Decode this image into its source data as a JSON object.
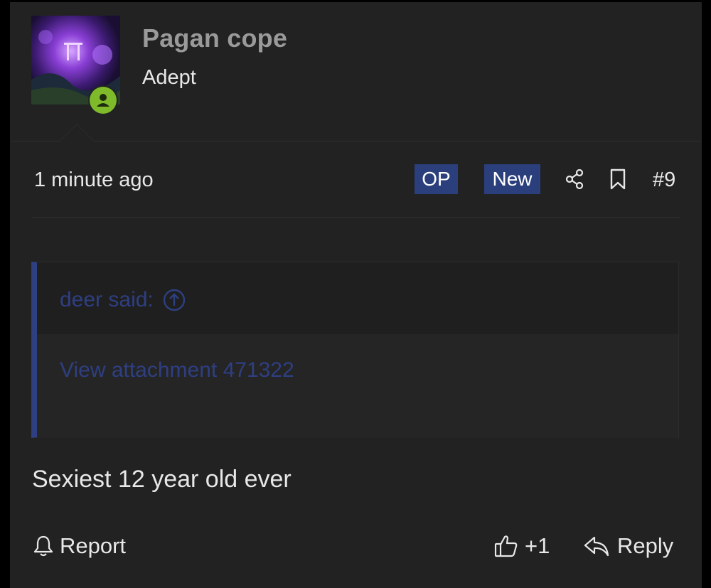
{
  "user": {
    "name": "Pagan cope",
    "title": "Adept",
    "online_icon": "user-online-icon"
  },
  "meta": {
    "time": "1 minute ago",
    "badge_op": "OP",
    "badge_new": "New",
    "post_number": "#9"
  },
  "quote": {
    "author": "deer said:",
    "attachment_link": "View attachment 471322"
  },
  "message": "Sexiest 12 year old ever",
  "footer": {
    "report_label": "Report",
    "like_label": "+1",
    "reply_label": "Reply"
  },
  "colors": {
    "background": "#222222",
    "badge": "#2b3f7c",
    "quote_accent": "#2e3f82",
    "online": "#7fba2a"
  }
}
